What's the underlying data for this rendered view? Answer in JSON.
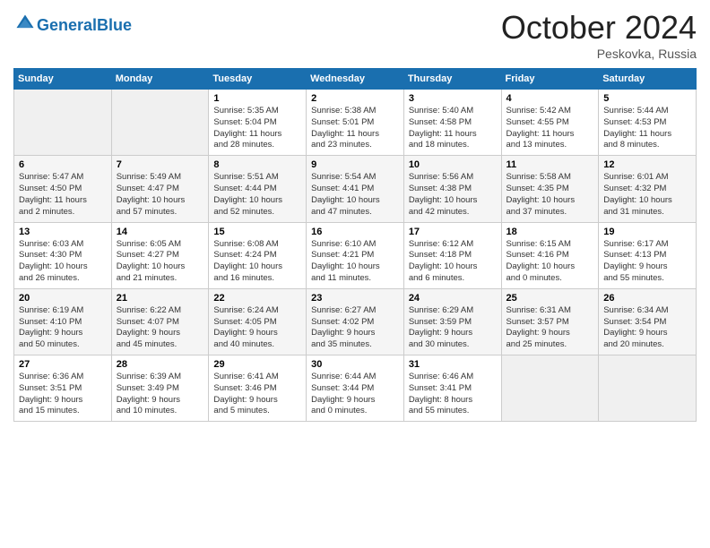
{
  "header": {
    "logo_general": "General",
    "logo_blue": "Blue",
    "month_title": "October 2024",
    "location": "Peskovka, Russia"
  },
  "days_of_week": [
    "Sunday",
    "Monday",
    "Tuesday",
    "Wednesday",
    "Thursday",
    "Friday",
    "Saturday"
  ],
  "weeks": [
    [
      {
        "day": "",
        "content": ""
      },
      {
        "day": "",
        "content": ""
      },
      {
        "day": "1",
        "content": "Sunrise: 5:35 AM\nSunset: 5:04 PM\nDaylight: 11 hours\nand 28 minutes."
      },
      {
        "day": "2",
        "content": "Sunrise: 5:38 AM\nSunset: 5:01 PM\nDaylight: 11 hours\nand 23 minutes."
      },
      {
        "day": "3",
        "content": "Sunrise: 5:40 AM\nSunset: 4:58 PM\nDaylight: 11 hours\nand 18 minutes."
      },
      {
        "day": "4",
        "content": "Sunrise: 5:42 AM\nSunset: 4:55 PM\nDaylight: 11 hours\nand 13 minutes."
      },
      {
        "day": "5",
        "content": "Sunrise: 5:44 AM\nSunset: 4:53 PM\nDaylight: 11 hours\nand 8 minutes."
      }
    ],
    [
      {
        "day": "6",
        "content": "Sunrise: 5:47 AM\nSunset: 4:50 PM\nDaylight: 11 hours\nand 2 minutes."
      },
      {
        "day": "7",
        "content": "Sunrise: 5:49 AM\nSunset: 4:47 PM\nDaylight: 10 hours\nand 57 minutes."
      },
      {
        "day": "8",
        "content": "Sunrise: 5:51 AM\nSunset: 4:44 PM\nDaylight: 10 hours\nand 52 minutes."
      },
      {
        "day": "9",
        "content": "Sunrise: 5:54 AM\nSunset: 4:41 PM\nDaylight: 10 hours\nand 47 minutes."
      },
      {
        "day": "10",
        "content": "Sunrise: 5:56 AM\nSunset: 4:38 PM\nDaylight: 10 hours\nand 42 minutes."
      },
      {
        "day": "11",
        "content": "Sunrise: 5:58 AM\nSunset: 4:35 PM\nDaylight: 10 hours\nand 37 minutes."
      },
      {
        "day": "12",
        "content": "Sunrise: 6:01 AM\nSunset: 4:32 PM\nDaylight: 10 hours\nand 31 minutes."
      }
    ],
    [
      {
        "day": "13",
        "content": "Sunrise: 6:03 AM\nSunset: 4:30 PM\nDaylight: 10 hours\nand 26 minutes."
      },
      {
        "day": "14",
        "content": "Sunrise: 6:05 AM\nSunset: 4:27 PM\nDaylight: 10 hours\nand 21 minutes."
      },
      {
        "day": "15",
        "content": "Sunrise: 6:08 AM\nSunset: 4:24 PM\nDaylight: 10 hours\nand 16 minutes."
      },
      {
        "day": "16",
        "content": "Sunrise: 6:10 AM\nSunset: 4:21 PM\nDaylight: 10 hours\nand 11 minutes."
      },
      {
        "day": "17",
        "content": "Sunrise: 6:12 AM\nSunset: 4:18 PM\nDaylight: 10 hours\nand 6 minutes."
      },
      {
        "day": "18",
        "content": "Sunrise: 6:15 AM\nSunset: 4:16 PM\nDaylight: 10 hours\nand 0 minutes."
      },
      {
        "day": "19",
        "content": "Sunrise: 6:17 AM\nSunset: 4:13 PM\nDaylight: 9 hours\nand 55 minutes."
      }
    ],
    [
      {
        "day": "20",
        "content": "Sunrise: 6:19 AM\nSunset: 4:10 PM\nDaylight: 9 hours\nand 50 minutes."
      },
      {
        "day": "21",
        "content": "Sunrise: 6:22 AM\nSunset: 4:07 PM\nDaylight: 9 hours\nand 45 minutes."
      },
      {
        "day": "22",
        "content": "Sunrise: 6:24 AM\nSunset: 4:05 PM\nDaylight: 9 hours\nand 40 minutes."
      },
      {
        "day": "23",
        "content": "Sunrise: 6:27 AM\nSunset: 4:02 PM\nDaylight: 9 hours\nand 35 minutes."
      },
      {
        "day": "24",
        "content": "Sunrise: 6:29 AM\nSunset: 3:59 PM\nDaylight: 9 hours\nand 30 minutes."
      },
      {
        "day": "25",
        "content": "Sunrise: 6:31 AM\nSunset: 3:57 PM\nDaylight: 9 hours\nand 25 minutes."
      },
      {
        "day": "26",
        "content": "Sunrise: 6:34 AM\nSunset: 3:54 PM\nDaylight: 9 hours\nand 20 minutes."
      }
    ],
    [
      {
        "day": "27",
        "content": "Sunrise: 6:36 AM\nSunset: 3:51 PM\nDaylight: 9 hours\nand 15 minutes."
      },
      {
        "day": "28",
        "content": "Sunrise: 6:39 AM\nSunset: 3:49 PM\nDaylight: 9 hours\nand 10 minutes."
      },
      {
        "day": "29",
        "content": "Sunrise: 6:41 AM\nSunset: 3:46 PM\nDaylight: 9 hours\nand 5 minutes."
      },
      {
        "day": "30",
        "content": "Sunrise: 6:44 AM\nSunset: 3:44 PM\nDaylight: 9 hours\nand 0 minutes."
      },
      {
        "day": "31",
        "content": "Sunrise: 6:46 AM\nSunset: 3:41 PM\nDaylight: 8 hours\nand 55 minutes."
      },
      {
        "day": "",
        "content": ""
      },
      {
        "day": "",
        "content": ""
      }
    ]
  ]
}
